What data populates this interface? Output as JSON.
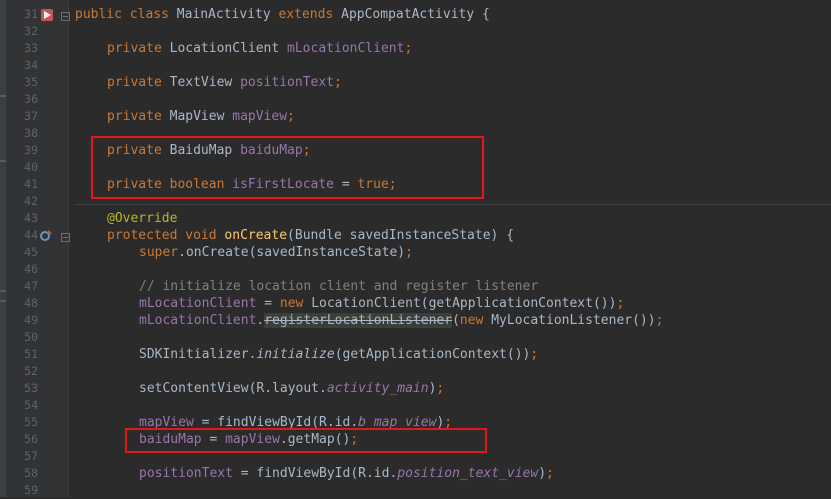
{
  "colors": {
    "background": "#2b2b2b",
    "gutter": "#313335",
    "keyword": "#cc7832",
    "field": "#9876aa",
    "method_decl": "#ffc66d",
    "annotation": "#bbb529",
    "comment": "#808080",
    "plain": "#a9b7c6",
    "highlight_box": "#e01818"
  },
  "gutter": {
    "line_numbers": [
      "31",
      "32",
      "33",
      "34",
      "35",
      "36",
      "37",
      "38",
      "39",
      "40",
      "41",
      "42",
      "43",
      "44",
      "45",
      "46",
      "47",
      "48",
      "49",
      "50",
      "51",
      "52",
      "53",
      "54",
      "55",
      "56",
      "57",
      "58",
      "59"
    ],
    "icons": [
      {
        "line": "31",
        "name": "run-gutter-icon"
      },
      {
        "line": "44",
        "name": "override-gutter-icon"
      }
    ]
  },
  "code": {
    "l31": {
      "t1": "public class ",
      "t2": "MainActivity ",
      "t3": "extends ",
      "t4": "AppCompatActivity {"
    },
    "l33": {
      "t1": "private ",
      "t2": "LocationClient ",
      "t3": "mLocationClient",
      "t4": ";"
    },
    "l35": {
      "t1": "private ",
      "t2": "TextView ",
      "t3": "positionText",
      "t4": ";"
    },
    "l37": {
      "t1": "private ",
      "t2": "MapView ",
      "t3": "mapView",
      "t4": ";"
    },
    "l39": {
      "t1": "private ",
      "t2": "BaiduMap ",
      "t3": "baiduMap",
      "t4": ";"
    },
    "l41": {
      "t1": "private ",
      "t2": "boolean ",
      "t3": "isFirstLocate",
      "t4": " = ",
      "t5": "true",
      "t6": ";"
    },
    "l43": {
      "t1": "@Override"
    },
    "l44": {
      "t1": "protected ",
      "t2": "void ",
      "t3": "onCreate",
      "t4": "(Bundle savedInstanceState) {"
    },
    "l45": {
      "t1": "super",
      "t2": ".onCreate(savedInstanceState)",
      "t3": ";"
    },
    "l47": {
      "t1": "// initialize location client and register listener"
    },
    "l48": {
      "t1": "mLocationClient",
      "t2": " = ",
      "t3": "new ",
      "t4": "LocationClient(getApplicationContext())",
      "t5": ";"
    },
    "l49": {
      "t1": "mLocationClient",
      "t2": ".",
      "t3": "registerLocationListener",
      "t4": "(",
      "t5": "new ",
      "t6": "MyLocationListener())",
      "t7": ";"
    },
    "l51": {
      "t1": "SDKInitializer.",
      "t2": "initialize",
      "t3": "(getApplicationContext())",
      "t4": ";"
    },
    "l53": {
      "t1": "setContentView(R.layout.",
      "t2": "activity_main",
      "t3": ")",
      "t4": ";"
    },
    "l55": {
      "t1": "mapView",
      "t2": " = findViewById(R.id.",
      "t3": "b_map_view",
      "t4": ")",
      "t5": ";"
    },
    "l56": {
      "t1": "baiduMap",
      "t2": " = ",
      "t3": "mapView",
      "t4": ".getMap()",
      "t5": ";"
    },
    "l58": {
      "t1": "positionText",
      "t2": " = findViewById(R.id.",
      "t3": "position_text_view",
      "t4": ")",
      "t5": ";"
    }
  }
}
